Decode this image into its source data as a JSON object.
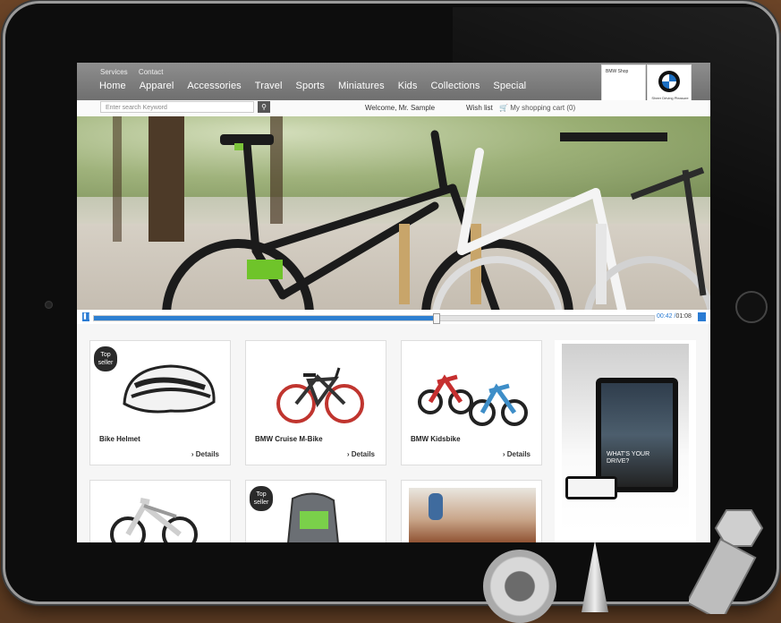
{
  "header": {
    "secondary_links": [
      "Services",
      "Contact"
    ],
    "nav": [
      "Home",
      "Apparel",
      "Accessories",
      "Travel",
      "Sports",
      "Miniatures",
      "Kids",
      "Collections",
      "Special"
    ],
    "brand_box_label": "BMW Shop",
    "tagline": "Sheer Driving Pleasure"
  },
  "toolbar": {
    "search_placeholder": "Enter search Keyword",
    "welcome": "Welcome, Mr. Sample",
    "wish_list": "Wish list",
    "cart": "My shopping cart (0)"
  },
  "video": {
    "progress": 0.61,
    "current": "00:42",
    "separator": "/",
    "total": "01:08"
  },
  "products": [
    {
      "name": "Bike Helmet",
      "badge": "Top seller",
      "details": "Details"
    },
    {
      "name": "BMW Cruise M-Bike",
      "badge": "",
      "details": "Details"
    },
    {
      "name": "BMW Kidsbike",
      "badge": "",
      "details": "Details"
    },
    {
      "name": "",
      "badge": "",
      "details": ""
    },
    {
      "name": "",
      "badge": "Top seller",
      "details": ""
    },
    {
      "name": "",
      "badge": "",
      "details": ""
    }
  ],
  "ad": {
    "headline": "WHAT'S YOUR DRIVE?"
  },
  "colors": {
    "accent": "#2a7bd3",
    "header": "#7f7f7f",
    "badge": "#2a2a2a"
  }
}
